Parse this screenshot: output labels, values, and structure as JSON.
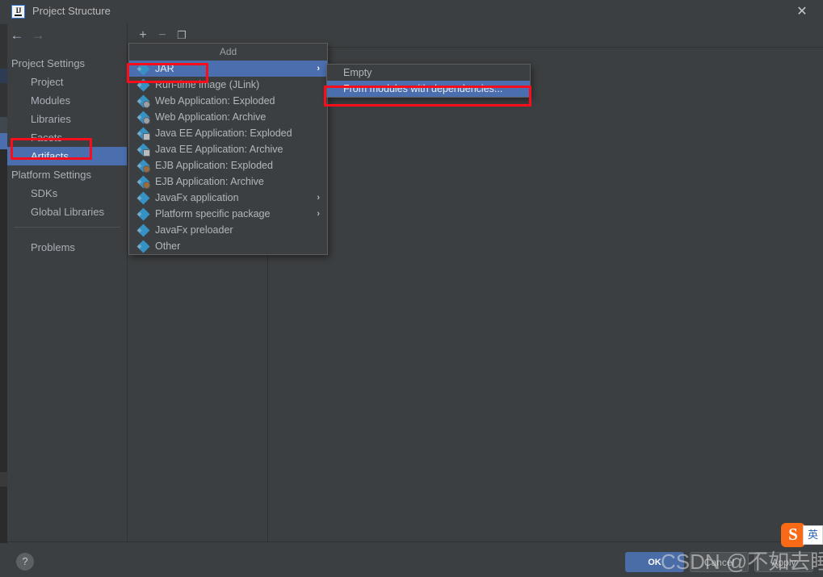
{
  "window": {
    "title": "Project Structure",
    "app_icon": "intellij-idea-icon",
    "close_label": "✕"
  },
  "nav": {
    "back_icon": "←",
    "forward_icon": "→",
    "groups": [
      {
        "label": "Project Settings",
        "items": [
          {
            "label": "Project",
            "selected": false
          },
          {
            "label": "Modules",
            "selected": false
          },
          {
            "label": "Libraries",
            "selected": false
          },
          {
            "label": "Facets",
            "selected": false
          },
          {
            "label": "Artifacts",
            "selected": true
          }
        ]
      },
      {
        "label": "Platform Settings",
        "items": [
          {
            "label": "SDKs",
            "selected": false
          },
          {
            "label": "Global Libraries",
            "selected": false
          }
        ]
      }
    ],
    "problems": {
      "label": "Problems"
    }
  },
  "toolbar": {
    "add_icon": "+",
    "remove_icon": "−",
    "copy_icon": "❐"
  },
  "popup": {
    "title": "Add",
    "items": [
      {
        "label": "JAR",
        "icon": "jar-icon",
        "selected": true,
        "submenu": true
      },
      {
        "label": "Run-time image (JLink)",
        "icon": "runtime-image-icon",
        "selected": false,
        "submenu": false
      },
      {
        "label": "Web Application: Exploded",
        "icon": "web-app-exploded-icon",
        "selected": false,
        "submenu": false
      },
      {
        "label": "Web Application: Archive",
        "icon": "web-app-archive-icon",
        "selected": false,
        "submenu": false
      },
      {
        "label": "Java EE Application: Exploded",
        "icon": "javaee-app-exploded-icon",
        "selected": false,
        "submenu": false
      },
      {
        "label": "Java EE Application: Archive",
        "icon": "javaee-app-archive-icon",
        "selected": false,
        "submenu": false
      },
      {
        "label": "EJB Application: Exploded",
        "icon": "ejb-app-exploded-icon",
        "selected": false,
        "submenu": false
      },
      {
        "label": "EJB Application: Archive",
        "icon": "ejb-app-archive-icon",
        "selected": false,
        "submenu": false
      },
      {
        "label": "JavaFx application",
        "icon": "javafx-application-icon",
        "selected": false,
        "submenu": true
      },
      {
        "label": "Platform specific package",
        "icon": "platform-package-icon",
        "selected": false,
        "submenu": true
      },
      {
        "label": "JavaFx preloader",
        "icon": "javafx-preloader-icon",
        "selected": false,
        "submenu": false
      },
      {
        "label": "Other",
        "icon": "other-artifact-icon",
        "selected": false,
        "submenu": false
      }
    ],
    "submenu_arrow": "›"
  },
  "submenu": {
    "items": [
      {
        "label": "Empty",
        "selected": false
      },
      {
        "label": "From modules with dependencies...",
        "selected": true
      }
    ]
  },
  "footer": {
    "help_label": "?",
    "ok_label": "OK",
    "cancel_label": "Cancel",
    "apply_label": "Apply"
  },
  "watermark": {
    "text": "CSDN @不如去睡觉_"
  },
  "ime": {
    "logo_text": "S",
    "panel_text": "英"
  },
  "colors": {
    "accent_selection": "#4b6eaf",
    "annotation": "#fc0d1b",
    "background": "#3c3f41",
    "ok_button": "#4a6da7"
  }
}
